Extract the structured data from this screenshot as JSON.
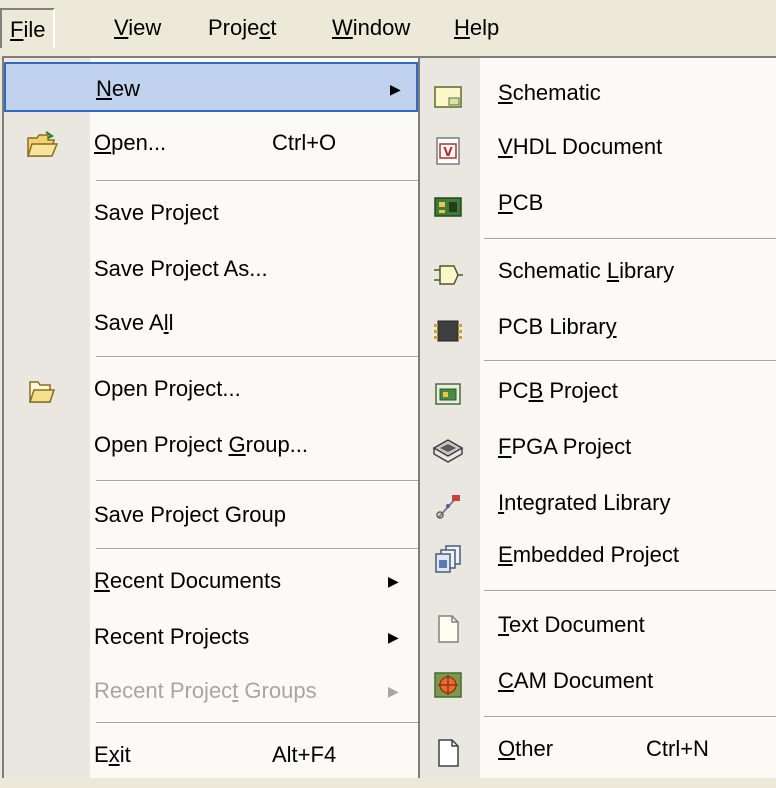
{
  "menubar": {
    "items": [
      {
        "label": "File",
        "u": "F",
        "rest": "ile"
      },
      {
        "label": "View",
        "u": "V",
        "rest": "iew"
      },
      {
        "label": "Project",
        "pre": "Proje",
        "u": "c",
        "rest": "t"
      },
      {
        "label": "Window",
        "u": "W",
        "rest": "indow"
      },
      {
        "label": "Help",
        "u": "H",
        "rest": "elp"
      }
    ]
  },
  "file_menu": {
    "new": {
      "pre": "",
      "u": "N",
      "post": "ew"
    },
    "open": {
      "pre": "",
      "u": "O",
      "post": "pen...",
      "shortcut": "Ctrl+O"
    },
    "save_project": "Save Project",
    "save_project_as": "Save Project As...",
    "save_all": {
      "pre": "Save A",
      "u": "l",
      "post": "l"
    },
    "open_project": "Open Project...",
    "open_project_group": {
      "pre": "Open Project ",
      "u": "G",
      "post": "roup..."
    },
    "save_project_group": "Save Project Group",
    "recent_documents": {
      "pre": "",
      "u": "R",
      "post": "ecent Documents"
    },
    "recent_projects": "Recent Projects",
    "recent_project_groups": {
      "pre": "Recent Projec",
      "u": "t",
      "post": " Groups"
    },
    "exit": {
      "pre": "E",
      "u": "x",
      "post": "it",
      "shortcut": "Alt+F4"
    }
  },
  "new_submenu": {
    "schematic": {
      "pre": "",
      "u": "S",
      "post": "chematic"
    },
    "vhdl_document": {
      "pre": "",
      "u": "V",
      "post": "HDL Document"
    },
    "pcb": {
      "pre": "",
      "u": "P",
      "post": "CB"
    },
    "schematic_library": {
      "pre": "Schematic ",
      "u": "L",
      "post": "ibrary"
    },
    "pcb_library": {
      "pre": "PCB Librar",
      "u": "y",
      "post": ""
    },
    "pcb_project": {
      "pre": "PC",
      "u": "B",
      "post": " Project"
    },
    "fpga_project": {
      "pre": "",
      "u": "F",
      "post": "PGA Project"
    },
    "integrated_library": {
      "pre": "",
      "u": "I",
      "post": "ntegrated Library"
    },
    "embedded_project": {
      "pre": "",
      "u": "E",
      "post": "mbedded Project"
    },
    "text_document": {
      "pre": "",
      "u": "T",
      "post": "ext Document"
    },
    "cam_document": {
      "pre": "",
      "u": "C",
      "post": "AM Document"
    },
    "other": {
      "pre": "",
      "u": "O",
      "post": "ther",
      "shortcut": "Ctrl+N"
    }
  },
  "icons": {
    "open": "folder-open-icon",
    "open_project": "project-folder-icon",
    "schematic": "schematic-icon",
    "vhdl": "vhdl-document-icon",
    "pcb": "pcb-icon",
    "schematic_library": "schematic-library-icon",
    "pcb_library": "pcb-library-icon",
    "pcb_project": "pcb-project-icon",
    "fpga_project": "fpga-project-icon",
    "integrated_library": "integrated-library-icon",
    "embedded_project": "embedded-project-icon",
    "text_document": "text-document-icon",
    "cam_document": "cam-document-icon",
    "other": "blank-document-icon"
  },
  "colors": {
    "highlight": "#c1d2ee",
    "highlight_border": "#316ac5",
    "disabled": "#a7a6a0"
  }
}
